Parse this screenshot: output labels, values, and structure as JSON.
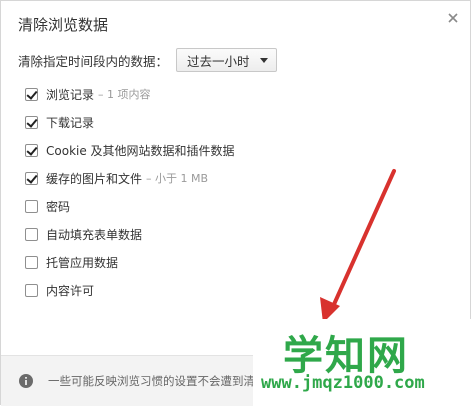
{
  "dialog": {
    "title": "清除浏览数据"
  },
  "range": {
    "label": "清除指定时间段内的数据：",
    "selected": "过去一小时"
  },
  "options": [
    {
      "label": "浏览记录",
      "note": "– 1 项内容",
      "checked": true
    },
    {
      "label": "下载记录",
      "note": "",
      "checked": true
    },
    {
      "label": "Cookie 及其他网站数据和插件数据",
      "note": "",
      "checked": true
    },
    {
      "label": "缓存的图片和文件",
      "note": "– 小于 1 MB",
      "checked": true
    },
    {
      "label": "密码",
      "note": "",
      "checked": false
    },
    {
      "label": "自动填充表单数据",
      "note": "",
      "checked": false
    },
    {
      "label": "托管应用数据",
      "note": "",
      "checked": false
    },
    {
      "label": "内容许可",
      "note": "",
      "checked": false
    }
  ],
  "footer": {
    "text": "一些可能反映浏览习惯的设置不会遭到清"
  },
  "watermark": {
    "main": "学知网",
    "url": "www.jmqz1000.com"
  },
  "colors": {
    "arrow": "#d8322e",
    "watermark": "#2fa84a"
  }
}
